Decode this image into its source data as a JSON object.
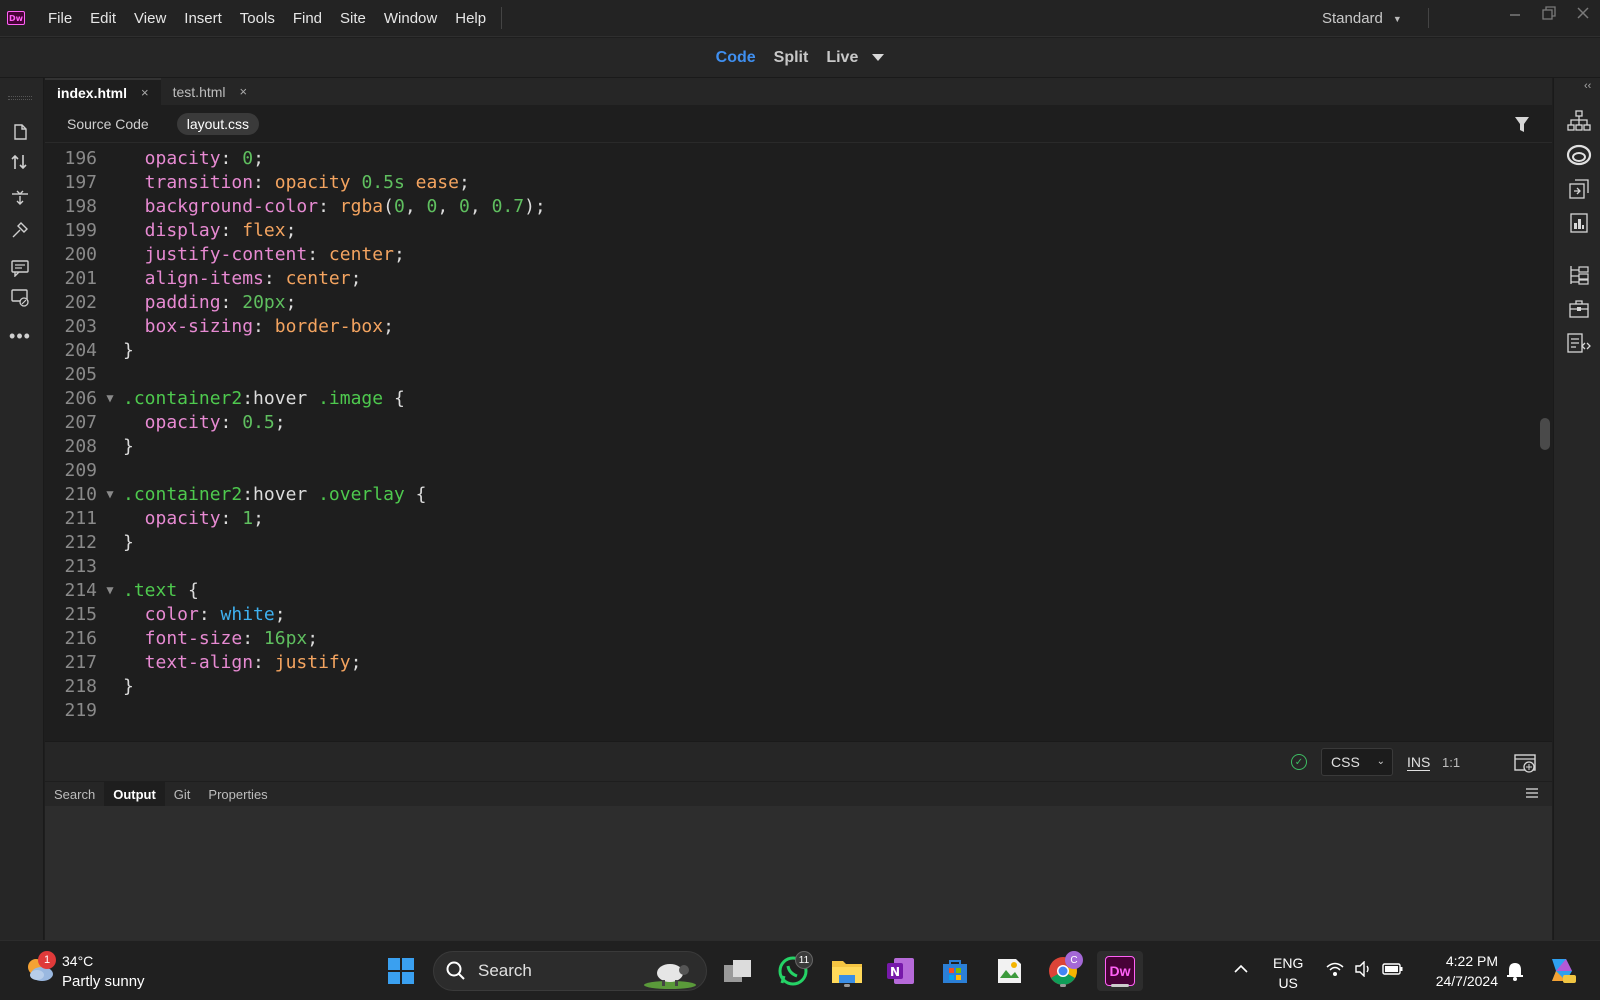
{
  "menubar": {
    "logo": "Dw",
    "items": [
      "File",
      "Edit",
      "View",
      "Insert",
      "Tools",
      "Find",
      "Site",
      "Window",
      "Help"
    ],
    "workspace": "Standard"
  },
  "view_switcher": {
    "code": "Code",
    "split": "Split",
    "live": "Live"
  },
  "doc_tabs": [
    {
      "label": "index.html",
      "close": "×"
    },
    {
      "label": "test.html",
      "close": "×"
    }
  ],
  "related_files": [
    "Source Code",
    "layout.css"
  ],
  "editor": {
    "lines": [
      {
        "n": "196",
        "fold": "",
        "tokens": [
          [
            "t-prop",
            "  opacity"
          ],
          [
            "t-punc",
            ": "
          ],
          [
            "t-num",
            "0"
          ],
          [
            "t-punc",
            ";"
          ]
        ]
      },
      {
        "n": "197",
        "fold": "",
        "tokens": [
          [
            "t-prop",
            "  transition"
          ],
          [
            "t-punc",
            ": "
          ],
          [
            "t-val",
            "opacity "
          ],
          [
            "t-num",
            "0.5s"
          ],
          [
            "t-val",
            " ease"
          ],
          [
            "t-punc",
            ";"
          ]
        ]
      },
      {
        "n": "198",
        "fold": "",
        "tokens": [
          [
            "t-prop",
            "  background-color"
          ],
          [
            "t-punc",
            ": "
          ],
          [
            "t-val",
            "rgba"
          ],
          [
            "t-punc",
            "("
          ],
          [
            "t-num",
            "0"
          ],
          [
            "t-punc",
            ", "
          ],
          [
            "t-num",
            "0"
          ],
          [
            "t-punc",
            ", "
          ],
          [
            "t-num",
            "0"
          ],
          [
            "t-punc",
            ", "
          ],
          [
            "t-num",
            "0.7"
          ],
          [
            "t-punc",
            ");"
          ]
        ]
      },
      {
        "n": "199",
        "fold": "",
        "tokens": [
          [
            "t-prop",
            "  display"
          ],
          [
            "t-punc",
            ": "
          ],
          [
            "t-val",
            "flex"
          ],
          [
            "t-punc",
            ";"
          ]
        ]
      },
      {
        "n": "200",
        "fold": "",
        "tokens": [
          [
            "t-prop",
            "  justify-content"
          ],
          [
            "t-punc",
            ": "
          ],
          [
            "t-val",
            "center"
          ],
          [
            "t-punc",
            ";"
          ]
        ]
      },
      {
        "n": "201",
        "fold": "",
        "tokens": [
          [
            "t-prop",
            "  align-items"
          ],
          [
            "t-punc",
            ": "
          ],
          [
            "t-val",
            "center"
          ],
          [
            "t-punc",
            ";"
          ]
        ]
      },
      {
        "n": "202",
        "fold": "",
        "tokens": [
          [
            "t-prop",
            "  padding"
          ],
          [
            "t-punc",
            ": "
          ],
          [
            "t-num",
            "20px"
          ],
          [
            "t-punc",
            ";"
          ]
        ]
      },
      {
        "n": "203",
        "fold": "",
        "tokens": [
          [
            "t-prop",
            "  box-sizing"
          ],
          [
            "t-punc",
            ": "
          ],
          [
            "t-val",
            "border-box"
          ],
          [
            "t-punc",
            ";"
          ]
        ]
      },
      {
        "n": "204",
        "fold": "",
        "tokens": [
          [
            "t-punc",
            "}"
          ]
        ]
      },
      {
        "n": "205",
        "fold": "",
        "tokens": []
      },
      {
        "n": "206",
        "fold": "▼",
        "tokens": [
          [
            "t-sel",
            ".container2"
          ],
          [
            "t-punc",
            ":hover "
          ],
          [
            "t-sel",
            ".image"
          ],
          [
            "t-punc",
            " {"
          ]
        ]
      },
      {
        "n": "207",
        "fold": "",
        "tokens": [
          [
            "t-prop",
            "  opacity"
          ],
          [
            "t-punc",
            ": "
          ],
          [
            "t-num",
            "0.5"
          ],
          [
            "t-punc",
            ";"
          ]
        ]
      },
      {
        "n": "208",
        "fold": "",
        "tokens": [
          [
            "t-punc",
            "}"
          ]
        ]
      },
      {
        "n": "209",
        "fold": "",
        "tokens": []
      },
      {
        "n": "210",
        "fold": "▼",
        "tokens": [
          [
            "t-sel",
            ".container2"
          ],
          [
            "t-punc",
            ":hover "
          ],
          [
            "t-sel",
            ".overlay"
          ],
          [
            "t-punc",
            " {"
          ]
        ]
      },
      {
        "n": "211",
        "fold": "",
        "tokens": [
          [
            "t-prop",
            "  opacity"
          ],
          [
            "t-punc",
            ": "
          ],
          [
            "t-num",
            "1"
          ],
          [
            "t-punc",
            ";"
          ]
        ]
      },
      {
        "n": "212",
        "fold": "",
        "tokens": [
          [
            "t-punc",
            "}"
          ]
        ]
      },
      {
        "n": "213",
        "fold": "",
        "tokens": []
      },
      {
        "n": "214",
        "fold": "▼",
        "tokens": [
          [
            "t-sel",
            ".text"
          ],
          [
            "t-punc",
            " {"
          ]
        ]
      },
      {
        "n": "215",
        "fold": "",
        "tokens": [
          [
            "t-prop",
            "  color"
          ],
          [
            "t-punc",
            ": "
          ],
          [
            "t-kw",
            "white"
          ],
          [
            "t-punc",
            ";"
          ]
        ]
      },
      {
        "n": "216",
        "fold": "",
        "tokens": [
          [
            "t-prop",
            "  font-size"
          ],
          [
            "t-punc",
            ": "
          ],
          [
            "t-num",
            "16px"
          ],
          [
            "t-punc",
            ";"
          ]
        ]
      },
      {
        "n": "217",
        "fold": "",
        "tokens": [
          [
            "t-prop",
            "  text-align"
          ],
          [
            "t-punc",
            ": "
          ],
          [
            "t-val",
            "justify"
          ],
          [
            "t-punc",
            ";"
          ]
        ]
      },
      {
        "n": "218",
        "fold": "",
        "tokens": [
          [
            "t-punc",
            "}"
          ]
        ]
      },
      {
        "n": "219",
        "fold": "",
        "tokens": []
      }
    ]
  },
  "statusbar": {
    "language": "CSS",
    "mode": "INS",
    "position": "1:1"
  },
  "bottom_panel": {
    "tabs": [
      "Search",
      "Output",
      "Git",
      "Properties"
    ],
    "active": "Output"
  },
  "taskbar": {
    "weather_temp": "34°C",
    "weather_desc": "Partly sunny",
    "weather_badge": "1",
    "search_label": "Search",
    "whatsapp_badge": "11",
    "chrome_badge": "C",
    "dw_label": "Dw",
    "lang_top": "ENG",
    "lang_bottom": "US",
    "time": "4:22 PM",
    "date": "24/7/2024"
  },
  "colors": {
    "accent": "#3f8ff0",
    "selector": "#4ec94e",
    "property": "#e78ad2",
    "value": "#f4a460",
    "number": "#5fbf5f",
    "keyword": "#3fb1f0"
  }
}
